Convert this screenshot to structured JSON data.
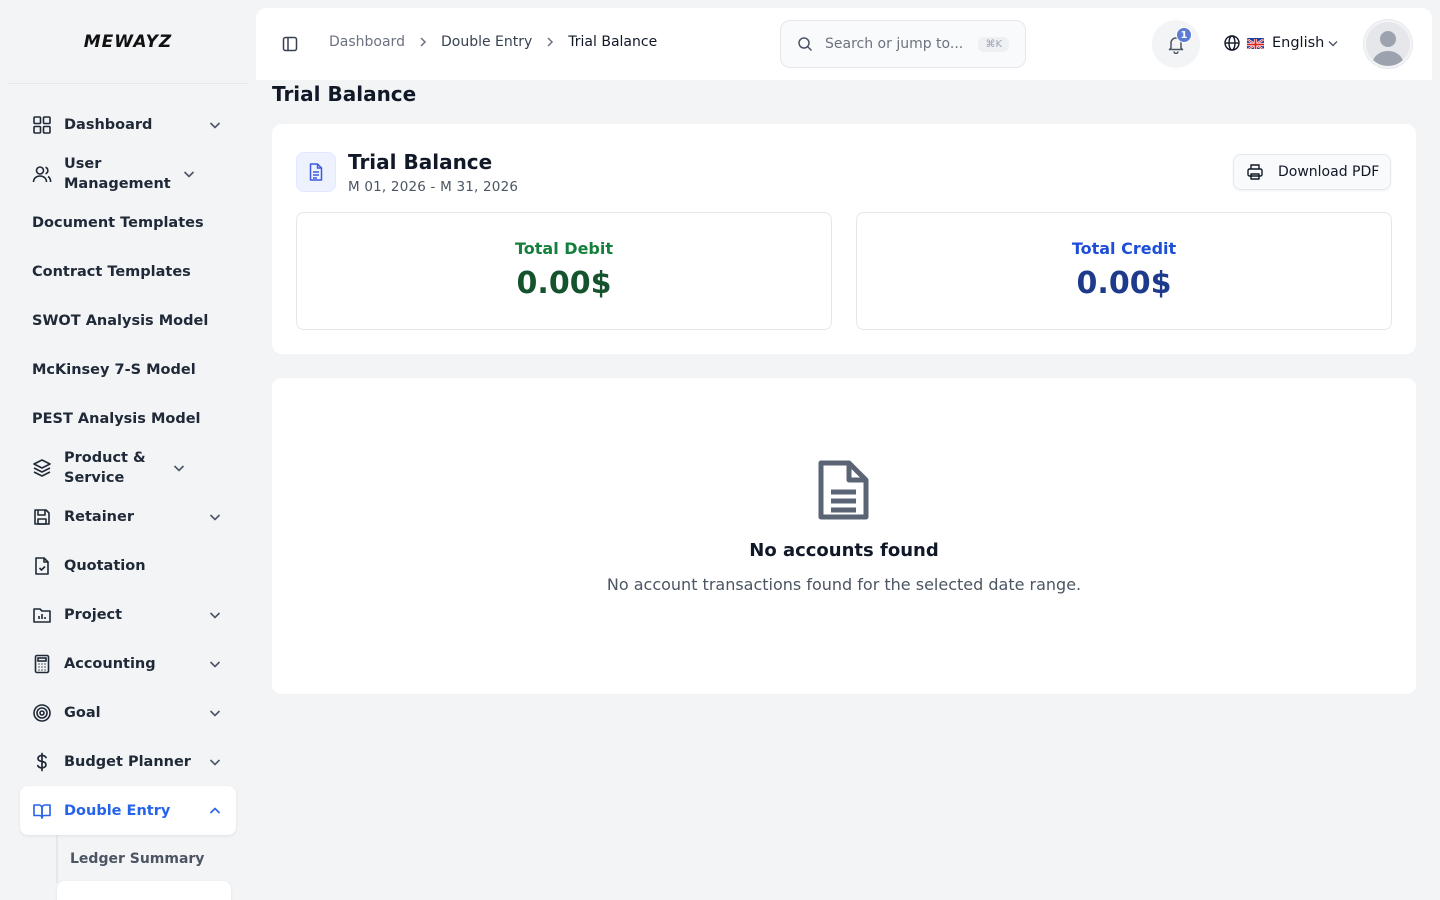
{
  "brand": {
    "logo_text": "MEWAYZ"
  },
  "sidebar": {
    "items": [
      {
        "label": "Dashboard",
        "icon": "grid-icon",
        "expandable": true
      },
      {
        "label": "User Management",
        "icon": "users-icon",
        "expandable": true
      },
      {
        "label": "Document Templates",
        "icon": "",
        "expandable": false
      },
      {
        "label": "Contract Templates",
        "icon": "",
        "expandable": false
      },
      {
        "label": "SWOT Analysis Model",
        "icon": "",
        "expandable": false
      },
      {
        "label": "McKinsey 7-S Model",
        "icon": "",
        "expandable": false
      },
      {
        "label": "PEST Analysis Model",
        "icon": "",
        "expandable": false
      },
      {
        "label": "Product & Service",
        "icon": "layers-icon",
        "expandable": true
      },
      {
        "label": "Retainer",
        "icon": "save-icon",
        "expandable": true
      },
      {
        "label": "Quotation",
        "icon": "file-check-icon",
        "expandable": false
      },
      {
        "label": "Project",
        "icon": "folder-chart-icon",
        "expandable": true
      },
      {
        "label": "Accounting",
        "icon": "calculator-icon",
        "expandable": true
      },
      {
        "label": "Goal",
        "icon": "target-icon",
        "expandable": true
      },
      {
        "label": "Budget Planner",
        "icon": "dollar-icon",
        "expandable": true
      },
      {
        "label": "Double Entry",
        "icon": "book-open-icon",
        "expandable": true,
        "active": true
      }
    ],
    "sub_items": [
      {
        "label": "Ledger Summary"
      }
    ]
  },
  "header": {
    "breadcrumb": [
      "Dashboard",
      "Double Entry",
      "Trial Balance"
    ],
    "search_placeholder": "Search or jump to...",
    "search_shortcut": "⌘K",
    "notification_count": "1",
    "language": "English"
  },
  "page": {
    "title": "Trial Balance",
    "card": {
      "title": "Trial Balance",
      "date_range": "M 01, 2026 - M 31, 2026",
      "download_label": "Download PDF",
      "total_debit_label": "Total Debit",
      "total_debit_value": "0.00$",
      "total_credit_label": "Total Credit",
      "total_credit_value": "0.00$"
    },
    "empty": {
      "title": "No accounts found",
      "description": "No account transactions found for the selected date range."
    }
  },
  "colors": {
    "accent": "#2563eb",
    "debit": "#15803d",
    "credit": "#1d4ed8"
  }
}
